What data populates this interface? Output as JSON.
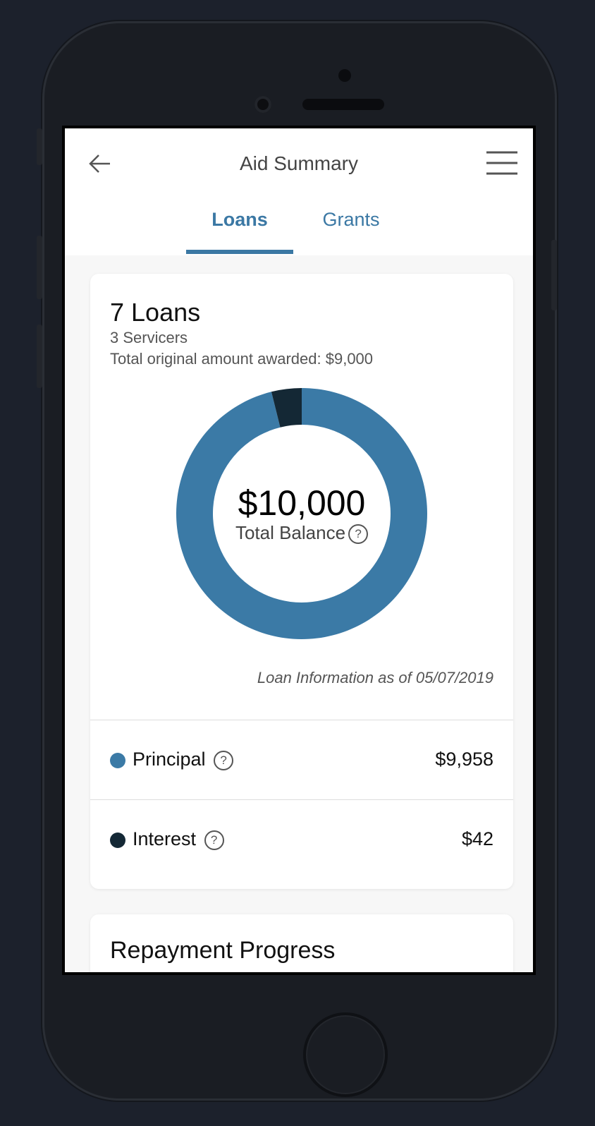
{
  "header": {
    "title": "Aid Summary"
  },
  "tabs": [
    {
      "label": "Loans",
      "active": true
    },
    {
      "label": "Grants",
      "active": false
    }
  ],
  "summary": {
    "loans_count": "7 Loans",
    "servicers": "3 Servicers",
    "awarded": "Total original amount awarded: $9,000",
    "total_amount": "$10,000",
    "total_label": "Total Balance",
    "as_of": "Loan Information as of 05/07/2019"
  },
  "breakdown": [
    {
      "label": "Principal",
      "value": "$9,958",
      "amount": 9958,
      "color": "#3b7aa6"
    },
    {
      "label": "Interest",
      "value": "$42",
      "amount": 42,
      "color": "#142835"
    }
  ],
  "repayment": {
    "title": "Repayment Progress"
  },
  "help_glyph": "?"
}
